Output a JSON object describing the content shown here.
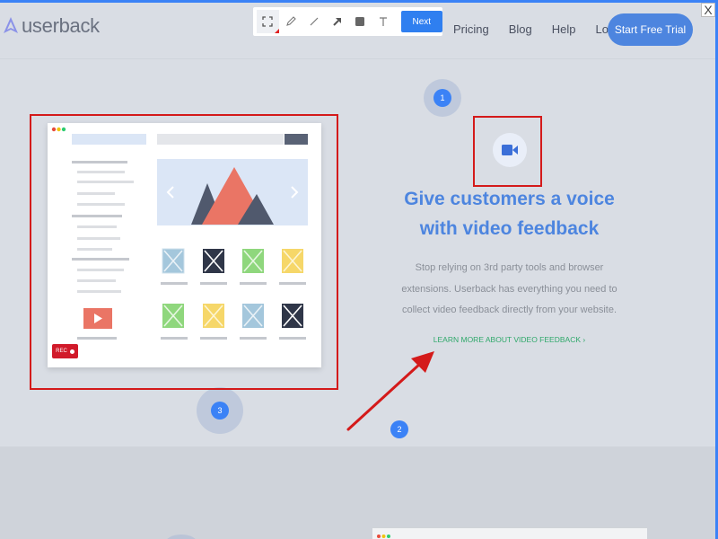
{
  "header": {
    "logo_text": "userback",
    "nav": [
      {
        "label": "Pricing"
      },
      {
        "label": "Blog"
      },
      {
        "label": "Help"
      },
      {
        "label": "Log In"
      }
    ],
    "cta_label": "Start Free Trial"
  },
  "toolbar": {
    "tools": [
      "select-area-icon",
      "pen-icon",
      "line-icon",
      "arrow-icon",
      "rectangle-icon",
      "text-icon"
    ],
    "next_label": "Next"
  },
  "close_label": "X",
  "markers": [
    "1",
    "2",
    "3"
  ],
  "content": {
    "headline_line1": "Give customers a voice",
    "headline_line2": "with video feedback",
    "desc_line1": "Stop relying on 3rd party tools and browser",
    "desc_line2": "extensions. Userback has everything you need to",
    "desc_line3": "collect video feedback directly from your website.",
    "learn_more": "LEARN MORE ABOUT VIDEO FEEDBACK ›"
  },
  "mock": {
    "rec_label": "REC"
  },
  "colors": {
    "accent": "#4d85df",
    "annotation_red": "#d41a1a",
    "marker_blue": "#3b82f6",
    "link_green": "#2fa86a"
  }
}
